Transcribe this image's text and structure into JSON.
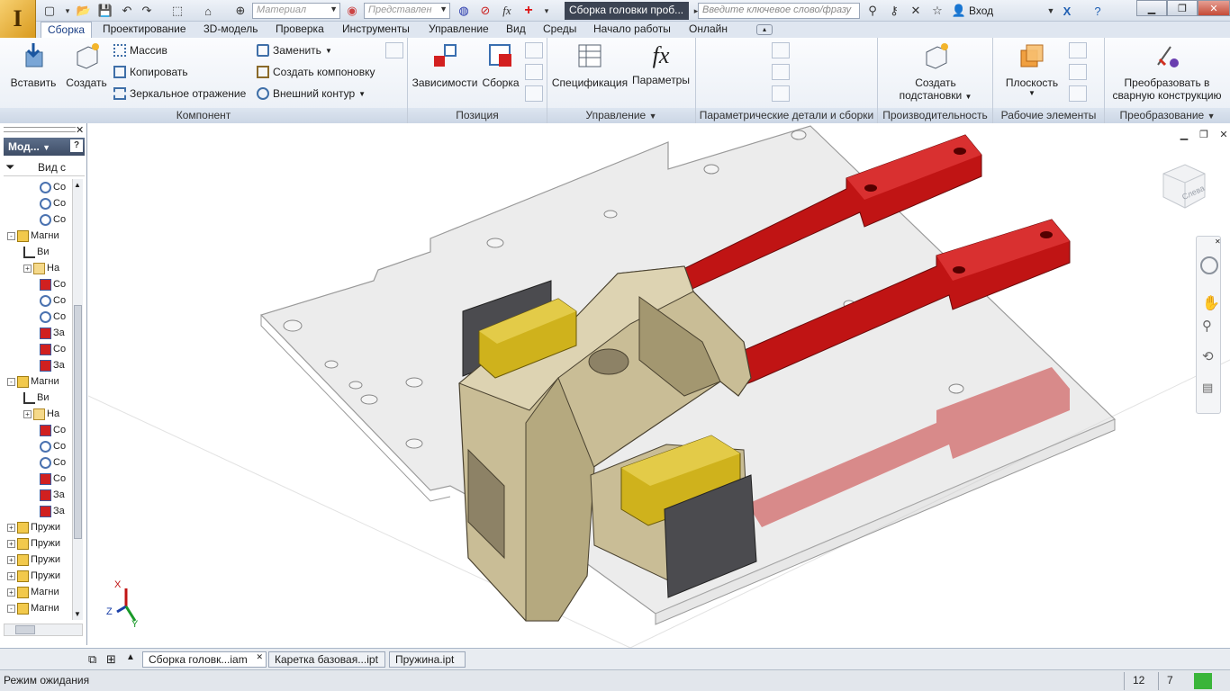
{
  "app": {
    "logo_letter": "I",
    "document_title": "Сборка головки проб..."
  },
  "quick_access": {
    "material_placeholder": "Материал",
    "representation_placeholder": "Представлен",
    "search_placeholder": "Введите ключевое слово/фразу",
    "login_label": "Вход"
  },
  "menu_tabs": [
    {
      "label": "Сборка"
    },
    {
      "label": "Проектирование"
    },
    {
      "label": "3D-модель"
    },
    {
      "label": "Проверка"
    },
    {
      "label": "Инструменты"
    },
    {
      "label": "Управление"
    },
    {
      "label": "Вид"
    },
    {
      "label": "Среды"
    },
    {
      "label": "Начало работы"
    },
    {
      "label": "Онлайн"
    }
  ],
  "ribbon": {
    "component": {
      "title": "Компонент",
      "insert": "Вставить",
      "create": "Создать",
      "pattern": "Массив",
      "copy": "Копировать",
      "mirror": "Зеркальное отражение",
      "replace": "Заменить",
      "create_layout": "Создать компоновку",
      "shrinkwrap": "Внешний контур"
    },
    "position": {
      "title": "Позиция",
      "constrain": "Зависимости",
      "assemble": "Сборка"
    },
    "manage": {
      "title": "Управление",
      "bom": "Спецификация",
      "parameters": "Параметры"
    },
    "ipart": {
      "title": "Параметрические детали и сборки"
    },
    "productivity": {
      "title": "Производительность",
      "create_substitutes_1": "Создать",
      "create_substitutes_2": "подстановки"
    },
    "work_features": {
      "title": "Рабочие элементы",
      "plane": "Плоскость"
    },
    "convert": {
      "title": "Преобразование",
      "convert_1": "Преобразовать в",
      "convert_2": "сварную конструкцию"
    }
  },
  "browser": {
    "header": "Мод...",
    "view_label": "Вид с",
    "items": [
      {
        "label": "Со",
        "icon": "constraint-icon"
      },
      {
        "label": "Со",
        "icon": "constraint-icon"
      },
      {
        "label": "Со",
        "icon": "constraint-icon"
      },
      {
        "label": "Магни",
        "icon": "assembly-icon"
      },
      {
        "label": "Ви",
        "icon": "view-rep-icon"
      },
      {
        "label": "На",
        "icon": "folder-icon"
      },
      {
        "label": "Со",
        "icon": "red-constraint-icon"
      },
      {
        "label": "Со",
        "icon": "constraint-icon"
      },
      {
        "label": "Со",
        "icon": "constraint-icon"
      },
      {
        "label": "За",
        "icon": "red-constraint-icon"
      },
      {
        "label": "Со",
        "icon": "red-constraint-icon"
      },
      {
        "label": "За",
        "icon": "red-constraint-icon"
      },
      {
        "label": "Магни",
        "icon": "assembly-icon"
      },
      {
        "label": "Ви",
        "icon": "view-rep-icon"
      },
      {
        "label": "На",
        "icon": "folder-icon"
      },
      {
        "label": "Со",
        "icon": "red-constraint-icon"
      },
      {
        "label": "Со",
        "icon": "constraint-icon"
      },
      {
        "label": "Со",
        "icon": "constraint-icon"
      },
      {
        "label": "Со",
        "icon": "red-constraint-icon"
      },
      {
        "label": "За",
        "icon": "red-constraint-icon"
      },
      {
        "label": "За",
        "icon": "red-constraint-icon"
      },
      {
        "label": "Пружи",
        "icon": "assembly-icon"
      },
      {
        "label": "Пружи",
        "icon": "assembly-icon"
      },
      {
        "label": "Пружи",
        "icon": "assembly-icon"
      },
      {
        "label": "Пружи",
        "icon": "assembly-icon"
      },
      {
        "label": "Магни",
        "icon": "assembly-icon"
      },
      {
        "label": "Магни",
        "icon": "assembly-icon"
      }
    ]
  },
  "viewcube": {
    "face_label": "Слева"
  },
  "axes": {
    "x": "X",
    "y": "Y",
    "z": "Z"
  },
  "doc_tabs": [
    {
      "label": "Сборка головк...iam",
      "active": true
    },
    {
      "label": "Каретка базовая...ipt",
      "active": false
    },
    {
      "label": "Пружина.ipt",
      "active": false
    }
  ],
  "status": {
    "text": "Режим ожидания",
    "count1": "12",
    "count2": "7"
  },
  "colors": {
    "accent": "#1a3f86",
    "part_red": "#c01414",
    "part_tan": "#cfc39a",
    "part_yellow": "#cfb21c"
  }
}
